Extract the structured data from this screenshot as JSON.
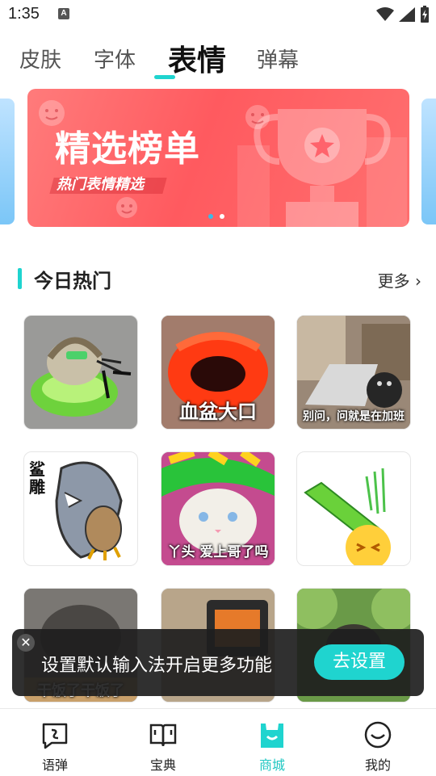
{
  "status": {
    "time": "1:35",
    "notif_icon": "A"
  },
  "tabs": [
    {
      "label": "皮肤"
    },
    {
      "label": "字体"
    },
    {
      "label": "表情",
      "active": true
    },
    {
      "label": "弹幕"
    }
  ],
  "banner": {
    "title": "精选榜单",
    "subtitle": "热门表情精选",
    "page_count": 2,
    "active_page": 1
  },
  "section": {
    "title": "今日热门",
    "more": "更多"
  },
  "stickers": [
    {
      "caption": "",
      "icon": "hedgehog-sticker"
    },
    {
      "caption": "血盆大口",
      "icon": "red-mouth-sticker"
    },
    {
      "caption": "别问，问就是在加班",
      "icon": "cat-laptop-sticker"
    },
    {
      "caption": "鲨雕",
      "icon": "shark-eagle-sticker"
    },
    {
      "caption": "丫头 爱上哥了吗",
      "icon": "cat-hat-sticker"
    },
    {
      "caption": "",
      "icon": "battery-emoji-sticker"
    },
    {
      "caption": "干饭了干饭了",
      "icon": "dog-sticker"
    },
    {
      "caption": "",
      "icon": "heater-sticker"
    },
    {
      "caption": "",
      "icon": "animal-tree-sticker"
    }
  ],
  "toast": {
    "text": "设置默认输入法开启更多功能",
    "button": "去设置"
  },
  "nav": [
    {
      "label": "语弹",
      "icon": "chat-bubble-icon"
    },
    {
      "label": "宝典",
      "icon": "book-icon"
    },
    {
      "label": "商城",
      "icon": "shop-icon",
      "active": true
    },
    {
      "label": "我的",
      "icon": "smile-face-icon"
    }
  ],
  "colors": {
    "accent": "#1fd4cf",
    "banner": "#ff5a5f"
  }
}
